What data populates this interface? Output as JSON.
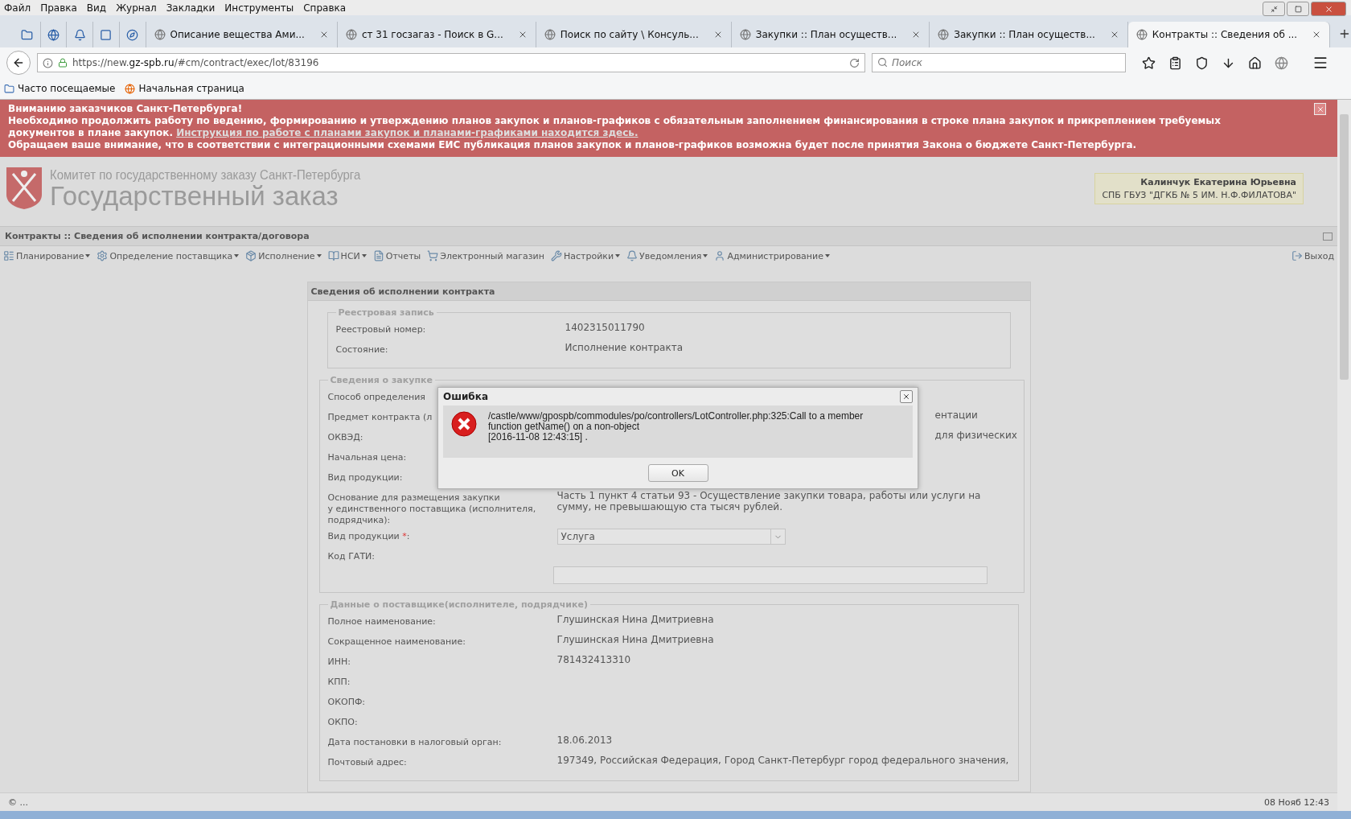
{
  "menu": [
    "Файл",
    "Правка",
    "Вид",
    "Журнал",
    "Закладки",
    "Инструменты",
    "Справка"
  ],
  "tabs": [
    {
      "kind": "pinned",
      "selected": false
    },
    {
      "kind": "pinned",
      "selected": false
    },
    {
      "kind": "pinned",
      "selected": false
    },
    {
      "kind": "pinned",
      "selected": false
    },
    {
      "kind": "pinned",
      "selected": false
    },
    {
      "kind": "normal",
      "label": "Описание вещества Ами...",
      "selected": false
    },
    {
      "kind": "normal",
      "label": "ст 31 госзагаз - Поиск в G...",
      "selected": false
    },
    {
      "kind": "normal",
      "label": "Поиск по сайту \\ Консуль...",
      "selected": false
    },
    {
      "kind": "normal",
      "label": "Закупки :: План осуществ...",
      "selected": false
    },
    {
      "kind": "normal",
      "label": "Закупки :: План осуществ...",
      "selected": false
    },
    {
      "kind": "normal",
      "label": "Контракты :: Сведения об ...",
      "selected": true
    }
  ],
  "address": {
    "url": "https://new.**gz-spb.ru**/#cm/contract/exec/lot/83196"
  },
  "search": {
    "placeholder": "Поиск"
  },
  "bookmarks": [
    "Часто посещаемые",
    "Начальная страница"
  ],
  "banner": {
    "title": "Вниманию заказчиков Санкт-Петербурга!",
    "text": "Необходимо продолжить работу по ведению, формированию и утверждению планов закупок и планов-графиков с обязательным заполнением финансирования в строке плана закупок и прикреплением требуемых документов в плане закупок.",
    "link": "Инструкция по работе с планами закупок и планами-графиками находится здесь.",
    "note": "Обращаем ваше внимание, что в соответствии с интеграционными схемами ЕИС публикация планов закупок и планов-графиков возможна будет после принятия Закона о бюджете Санкт-Петербурга."
  },
  "header": {
    "org": "Комитет по государственному заказу Санкт-Петербурга",
    "title": "Государственный заказ",
    "user": {
      "name": "Калинчук Екатерина Юрьевна",
      "org": "СПБ ГБУЗ \"ДГКБ № 5 ИМ. Н.Ф.ФИЛАТОВА\""
    }
  },
  "breadcrumb": "Контракты :: Сведения об исполнении контракта/договора",
  "toolbar": [
    {
      "label": "Планирование",
      "dropdown": true
    },
    {
      "label": "Определение поставщика",
      "dropdown": true
    },
    {
      "label": "Исполнение",
      "dropdown": true
    },
    {
      "label": "НСИ",
      "dropdown": true
    },
    {
      "label": "Отчеты",
      "dropdown": false
    },
    {
      "label": "Электронный магазин",
      "dropdown": false
    },
    {
      "label": "Настройки",
      "dropdown": true
    },
    {
      "label": "Уведомления",
      "dropdown": true
    },
    {
      "label": "Администрирование",
      "dropdown": true
    }
  ],
  "exit": "Выход",
  "panel": {
    "title": "Сведения об исполнении контракта",
    "sections": [
      {
        "legend": "Реестровая запись",
        "rows": [
          {
            "kind": "text",
            "label": "Реестровый номер:",
            "value": "1402315011790"
          },
          {
            "kind": "text",
            "label": "Состояние:",
            "value": "Исполнение контракта"
          }
        ]
      },
      {
        "legend": "Сведения о закупке",
        "rows": [
          {
            "kind": "text",
            "label": "Способ определения"
          },
          {
            "kind": "clipped",
            "label": "Предмет контракта (л",
            "value": "ентации"
          },
          {
            "kind": "clipped",
            "label": "ОКВЭД:",
            "value": "для физических"
          },
          {
            "kind": "text",
            "label": "Начальная цена:"
          },
          {
            "kind": "text",
            "label": "Вид продукции:"
          },
          {
            "kind": "text",
            "label": "Основание для размещения закупки\nу единственного поставщика (исполнителя,\nподрядчика):",
            "value": "Часть 1 пункт 4 статьи 93 - Осуществление закупки товара, работы или услуги на сумму, не превышающую ста тысяч рублей."
          },
          {
            "kind": "select",
            "label": "Вид продукции",
            "required_mark": "*",
            "label_end": ":",
            "value": "Услуга"
          },
          {
            "kind": "input",
            "label": "Код ГАТИ:"
          }
        ]
      },
      {
        "legend": "Данные о поставщике(исполнителе, подрядчике)",
        "rows": [
          {
            "kind": "text",
            "label": "Полное наименование:",
            "value": "Глушинская Нина Дмитриевна"
          },
          {
            "kind": "text",
            "label": "Сокращенное наименование:",
            "value": "Глушинская Нина Дмитриевна"
          },
          {
            "kind": "text",
            "label": "ИНН:",
            "value": "781432413310"
          },
          {
            "kind": "text",
            "label": "КПП:"
          },
          {
            "kind": "text",
            "label": "ОКОПФ:"
          },
          {
            "kind": "text",
            "label": "ОКПО:"
          },
          {
            "kind": "text",
            "label": "Дата постановки в налоговый орган:",
            "value": "18.06.2013"
          },
          {
            "kind": "text",
            "label": "Почтовый адрес:",
            "value": "197349, Российская Федерация, Город Санкт-Петербург город федерального значения,"
          }
        ]
      }
    ]
  },
  "dialog": {
    "title": "Ошибка",
    "message": "/castle/www/gpospb/commodules/po/controllers/LotController.php:325:Call to a member\nfunction getName() on a non-object\n[2016-11-08 12:43:15] .",
    "button": "OK"
  },
  "status": {
    "left": "© ...",
    "right": "08 Нояб 12:43"
  }
}
